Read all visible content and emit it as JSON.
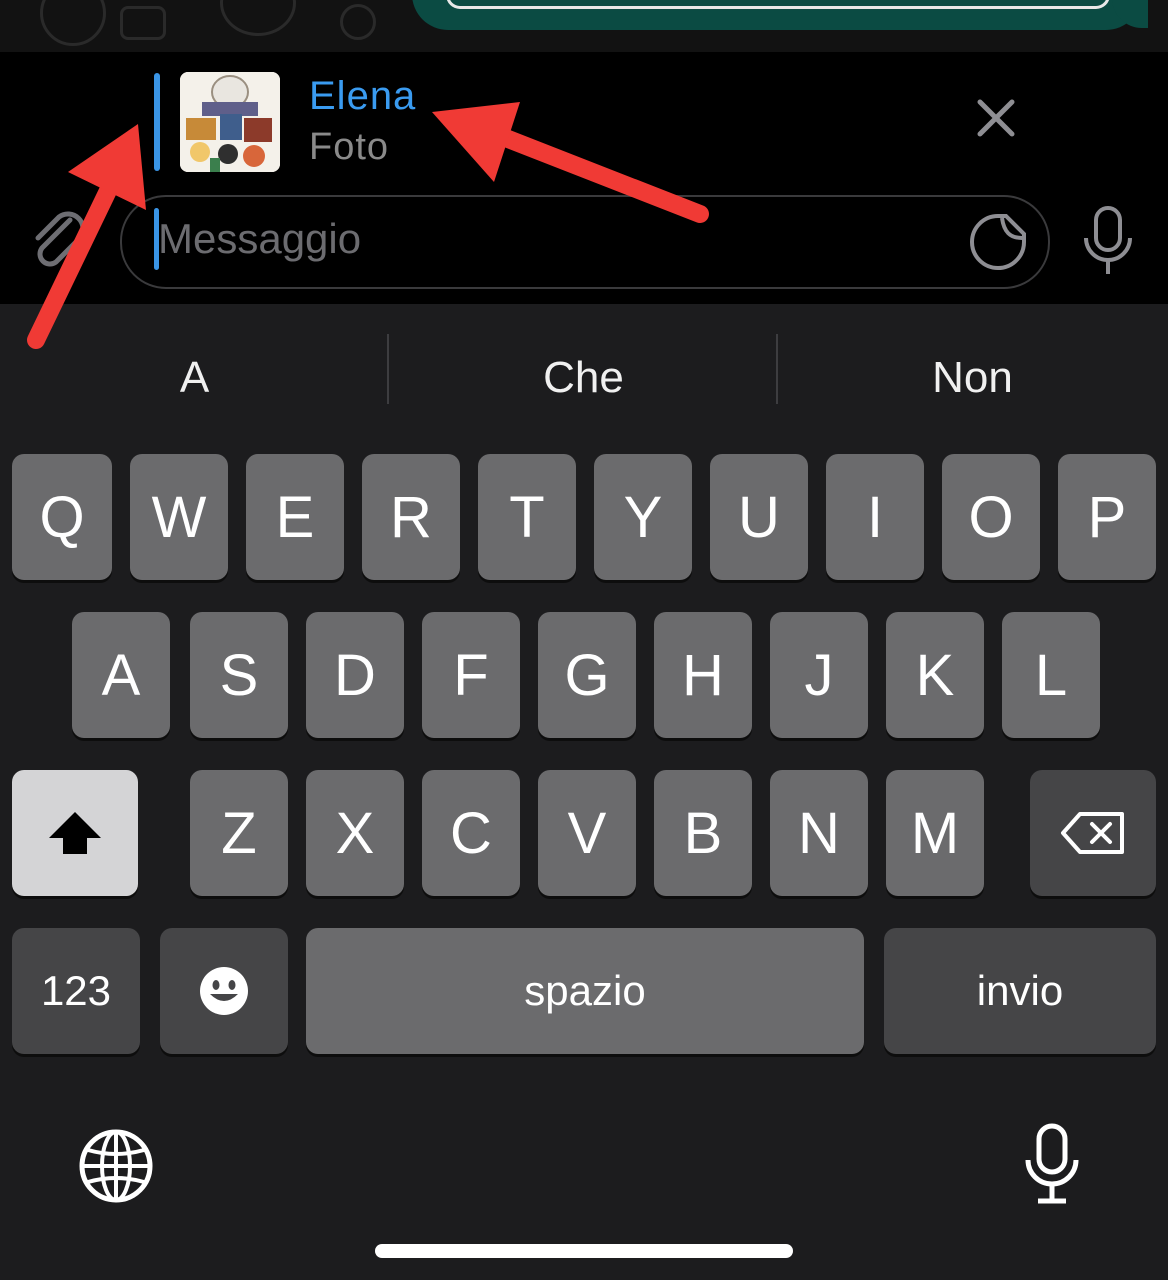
{
  "reply": {
    "name": "Elena",
    "type_label": "Foto"
  },
  "composer": {
    "placeholder": "Messaggio"
  },
  "suggestions": [
    "A",
    "Che",
    "Non"
  ],
  "keyboard": {
    "row1": [
      "Q",
      "W",
      "E",
      "R",
      "T",
      "Y",
      "U",
      "I",
      "O",
      "P"
    ],
    "row2": [
      "A",
      "S",
      "D",
      "F",
      "G",
      "H",
      "J",
      "K",
      "L"
    ],
    "row3": [
      "Z",
      "X",
      "C",
      "V",
      "B",
      "N",
      "M"
    ],
    "numbers_label": "123",
    "space_label": "spazio",
    "return_label": "invio"
  },
  "icons": {
    "close": "close-icon",
    "attach": "paperclip-icon",
    "sticker": "sticker-icon",
    "mic": "microphone-icon",
    "shift": "shift-icon",
    "backspace": "backspace-icon",
    "emoji": "emoji-icon",
    "globe": "globe-icon",
    "dictation": "dictation-mic-icon"
  },
  "colors": {
    "accent": "#3a95e6",
    "annotation": "#f03a35",
    "bubble": "#0b4b43"
  }
}
